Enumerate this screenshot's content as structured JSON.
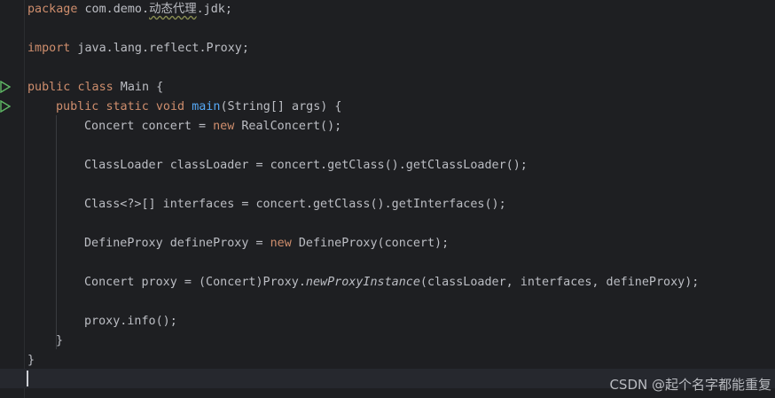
{
  "editor": {
    "lines": {
      "l1": {
        "kw": "package",
        "rest_a": " com.demo.",
        "cn": "动态代理",
        "rest_b": ".jdk;"
      },
      "l3": {
        "kw": "import",
        "rest": " java.lang.reflect.Proxy;"
      },
      "l5": {
        "kw1": "public",
        "kw2": "class",
        "rest": " Main {"
      },
      "l6": {
        "kw1": "public",
        "kw2": "static",
        "kw3": "void",
        "fn": "main",
        "rest": "(String[] args) {"
      },
      "l7": {
        "a": "Concert concert = ",
        "kw": "new",
        "b": " RealConcert();"
      },
      "l9": {
        "text": "ClassLoader classLoader = concert.getClass().getClassLoader();"
      },
      "l11": {
        "text": "Class<?>[] interfaces = concert.getClass().getInterfaces();"
      },
      "l13": {
        "a": "DefineProxy defineProxy = ",
        "kw": "new",
        "b": " DefineProxy(concert);"
      },
      "l15": {
        "a": "Concert proxy = (Concert)Proxy.",
        "it": "newProxyInstance",
        "b": "(classLoader, interfaces, defineProxy);"
      },
      "l17": {
        "text": "proxy.info();"
      },
      "l18": {
        "text": "}"
      },
      "l19": {
        "text": "}"
      }
    },
    "run_icons": [
      "run-class-icon",
      "run-main-icon"
    ]
  },
  "watermark": "CSDN @起个名字都能重复",
  "colors": {
    "background": "#1e1f22",
    "keyword": "#cf8e6d",
    "function": "#56a8f5",
    "text": "#bcbec4",
    "run_icon": "#5fb865"
  }
}
